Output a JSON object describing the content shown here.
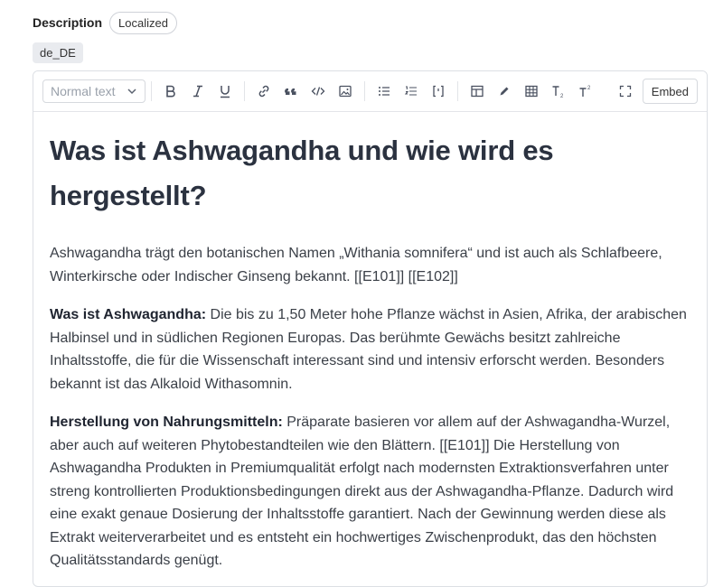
{
  "field": {
    "label": "Description",
    "badge": "Localized",
    "locale": "de_DE"
  },
  "toolbar": {
    "block_type": "Normal text",
    "buttons": [
      {
        "name": "bold-button",
        "icon": "bold-icon"
      },
      {
        "name": "italic-button",
        "icon": "italic-icon"
      },
      {
        "name": "underline-button",
        "icon": "underline-icon"
      },
      {
        "name": "link-button",
        "icon": "link-icon"
      },
      {
        "name": "quote-button",
        "icon": "quote-icon"
      },
      {
        "name": "code-button",
        "icon": "code-icon"
      },
      {
        "name": "image-button",
        "icon": "image-icon"
      },
      {
        "name": "bullet-list-button",
        "icon": "bullet-list-icon"
      },
      {
        "name": "numbered-list-button",
        "icon": "numbered-list-icon"
      },
      {
        "name": "code-block-button",
        "icon": "code-block-icon"
      },
      {
        "name": "layout-button",
        "icon": "layout-icon"
      },
      {
        "name": "highlight-button",
        "icon": "pen-icon"
      },
      {
        "name": "table-button",
        "icon": "table-icon"
      },
      {
        "name": "subscript-button",
        "icon": "subscript-icon"
      },
      {
        "name": "superscript-button",
        "icon": "superscript-icon"
      },
      {
        "name": "fullscreen-button",
        "icon": "fullscreen-icon"
      }
    ],
    "embed_label": "Embed"
  },
  "content": {
    "heading": "Was ist Ashwagandha und wie wird es hergestellt?",
    "p1": "Ashwagandha trägt den botanischen Namen „Withania somnifera“ und ist auch als Schlafbeere, Winterkirsche oder Indischer Ginseng bekannt. [[E101]] [[E102]]",
    "p2_bold": "Was ist Ashwagandha:",
    "p2_text": " Die bis zu 1,50 Meter hohe Pflanze wächst in Asien, Afrika, der arabischen Halbinsel und in südlichen Regionen Europas. Das berühmte Gewächs besitzt zahlreiche Inhaltsstoffe, die für die Wissenschaft interessant sind und intensiv erforscht werden. Besonders bekannt ist das Alkaloid Withasomnin.",
    "p3_bold": "Herstellung von Nahrungsmitteln:",
    "p3_text": " Präparate basieren vor allem auf der Ashwagandha-Wurzel, aber auch auf weiteren Phytobestandteilen wie den Blättern. [[E101]] Die Herstellung von Ashwagandha Produkten in Premiumqualität erfolgt nach modernsten Extraktionsverfahren unter streng kontrollierten Produktionsbedingungen direkt aus der Ashwagandha-Pflanze. Dadurch wird eine exakt genaue Dosierung der Inhaltsstoffe garantiert. Nach der Gewinnung werden diese als Extrakt weiterverarbeitet und es entsteht ein hochwertiges Zwischenprodukt, das den höchsten Qualitätsstandards genügt."
  }
}
